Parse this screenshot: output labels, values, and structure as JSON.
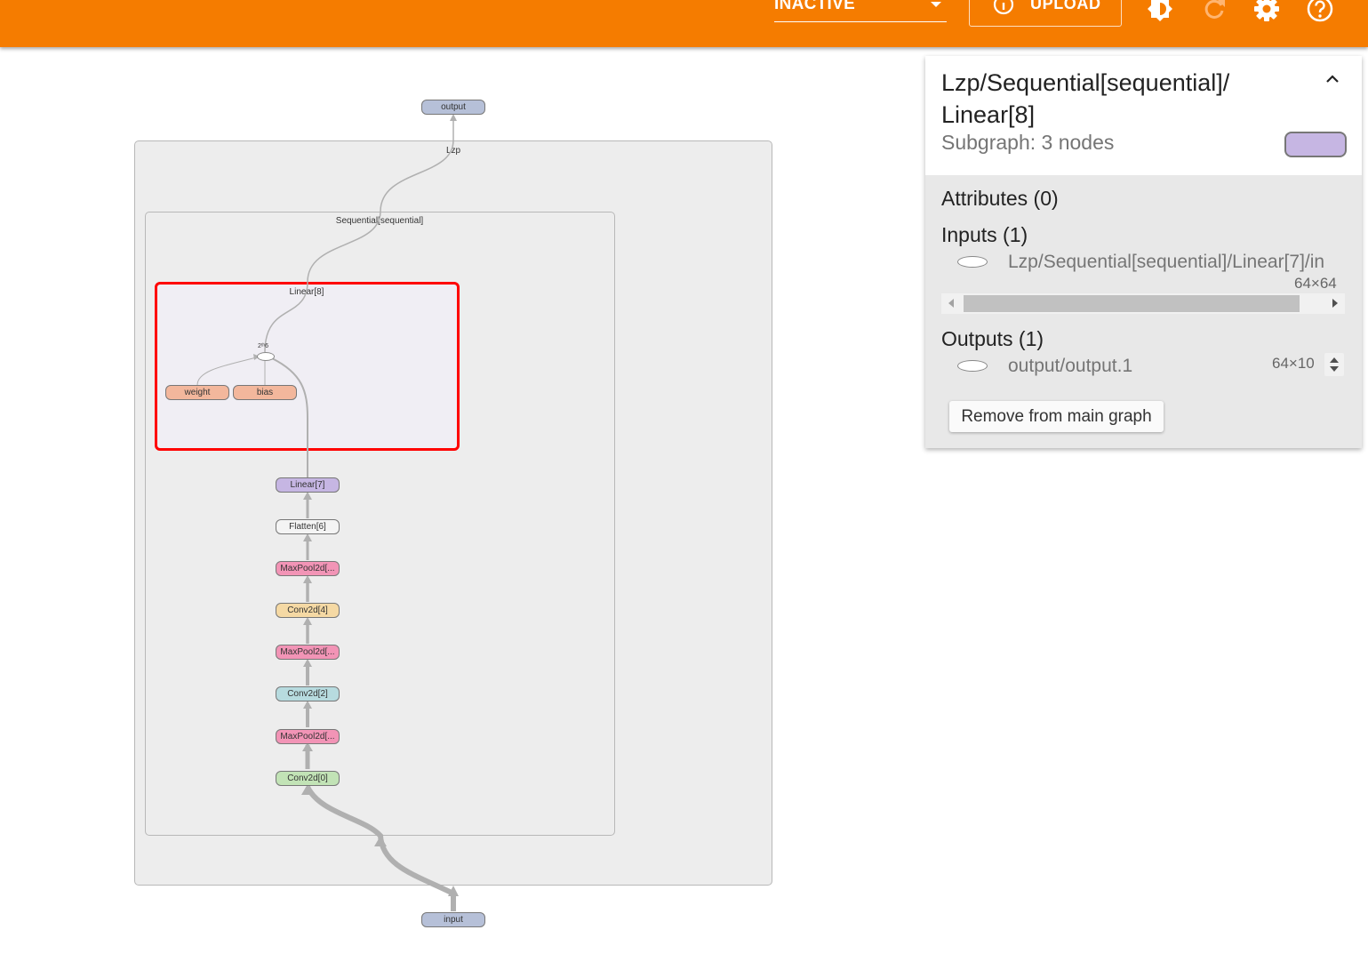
{
  "toolbar": {
    "run_select_value": "INACTIVE",
    "upload_label": "UPLOAD",
    "icons": [
      "upload-info-icon",
      "brightness-icon",
      "refresh-icon",
      "settings-icon",
      "help-icon"
    ]
  },
  "graph": {
    "clusters": {
      "outer": "Lzp",
      "sequential": "Sequential[sequential]",
      "selected": "Linear[8]"
    },
    "op_node_label": "2ᵗʰ6",
    "nodes": {
      "output": "output",
      "input": "input",
      "weight": "weight",
      "bias": "bias",
      "linear7": "Linear[7]",
      "flatten6": "Flatten[6]",
      "maxpool5": "MaxPool2d[...",
      "conv4": "Conv2d[4]",
      "maxpool3": "MaxPool2d[...",
      "conv2": "Conv2d[2]",
      "maxpool1": "MaxPool2d[...",
      "conv0": "Conv2d[0]"
    },
    "colors": {
      "io_node": "#b6c0d8",
      "param_node": "#f3b79c",
      "linear": "#c6b6e3",
      "flatten": "#f4f4f4",
      "maxpool": "#f294b6",
      "conv4": "#f5d9a4",
      "conv2": "#b7dbdf",
      "conv0": "#c2e3b6",
      "selection": "#ff0000",
      "toolbar": "#f57c00"
    }
  },
  "info_card": {
    "title": "Lzp/Sequential[sequential]/\nLinear[8]",
    "subtitle": "Subgraph: 3 nodes",
    "attributes_title": "Attributes (0)",
    "inputs_title": "Inputs (1)",
    "input_name": "Lzp/Sequential[sequential]/Linear[7]/in",
    "input_shape": "64×64",
    "outputs_title": "Outputs (1)",
    "output_name": "output/output.1",
    "output_shape": "64×10",
    "remove_button": "Remove from main graph"
  }
}
